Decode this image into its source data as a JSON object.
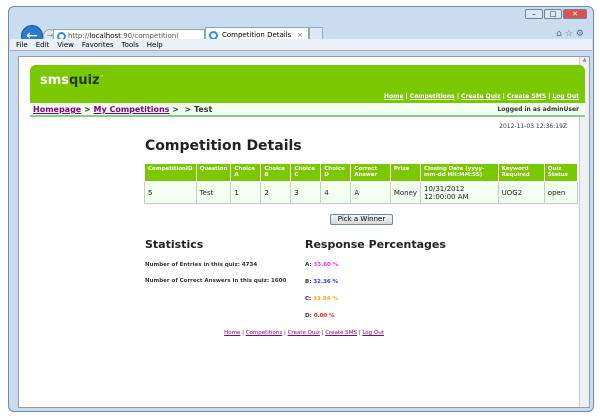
{
  "browser": {
    "url_prefix": "http://",
    "url_host": "localhost",
    "url_rest": ":90/competition(",
    "tab_title": "Competition Details",
    "menu": [
      "File",
      "Edit",
      "View",
      "Favorites",
      "Tools",
      "Help"
    ]
  },
  "site": {
    "logo_sms": "sms",
    "logo_quiz": "quiz",
    "logo_tm": "™",
    "top_links": [
      "Home",
      "Competitions",
      "Create Quiz",
      "Create SMS",
      "Log Out"
    ],
    "breadcrumb": {
      "home": "Homepage",
      "comps": "My Competitions",
      "current": "> Test"
    },
    "logged_in": "Logged in as adminUser",
    "timestamp": "2012-11-03 12:36:19Z"
  },
  "main": {
    "title": "Competition Details",
    "table": {
      "headers": [
        "CompetitionID",
        "Question",
        "Choice A",
        "Choice B",
        "Choice C",
        "Choice D",
        "Correct Answer",
        "Prize",
        "Closing Date (yyyy-mm-dd HH:MM:SS)",
        "Keyword Required",
        "Quiz Status"
      ],
      "row": [
        "5",
        "Test",
        "1",
        "2",
        "3",
        "4",
        "A",
        "Money",
        "10/31/2012 12:00:00 AM",
        "UOG2",
        "open"
      ]
    },
    "pick_winner": "Pick a Winner",
    "statistics": {
      "title": "Statistics",
      "entries_label": "Number of Entries in this quiz:",
      "entries": "4734",
      "correct_label": "Number of Correct Answers in this quiz:",
      "correct": "1600"
    },
    "responses": {
      "title": "Response Percentages",
      "items": [
        {
          "label": "A:",
          "value": "33.80 %",
          "color": "#ff33ff"
        },
        {
          "label": "B:",
          "value": "32.36 %",
          "color": "#3333ff"
        },
        {
          "label": "C:",
          "value": "33.84 %",
          "color": "#ffaa22"
        },
        {
          "label": "D:",
          "value": "0.00 %",
          "color": "#ff2222"
        }
      ]
    }
  },
  "footer": [
    "Home",
    "Competitions",
    "Create Quiz",
    "Create SMS",
    "Log Out"
  ]
}
